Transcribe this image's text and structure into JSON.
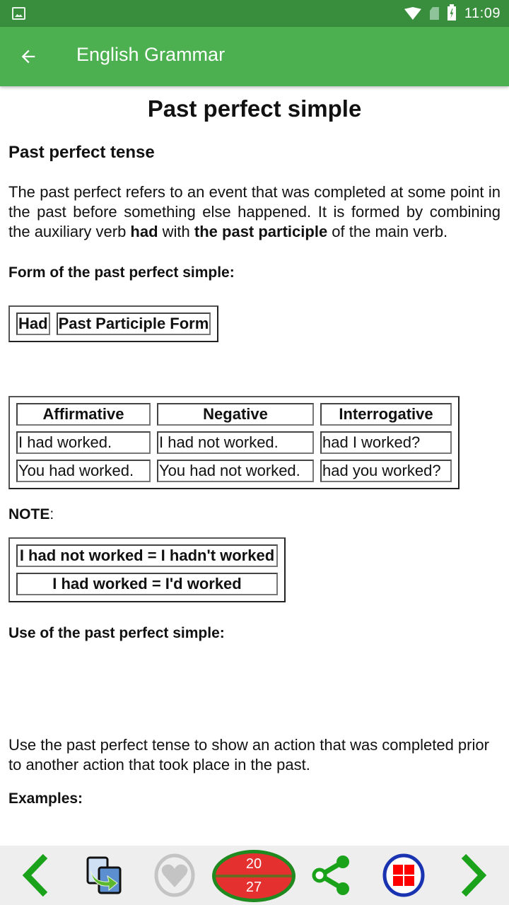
{
  "status_bar": {
    "time": "11:09",
    "icons": [
      "gallery-icon",
      "wifi-icon",
      "no-sim-icon",
      "battery-charging-icon"
    ]
  },
  "app_bar": {
    "title": "English Grammar",
    "back_icon": "arrow-left-icon"
  },
  "page": {
    "title": "Past perfect simple",
    "section_heading": "Past perfect tense",
    "intro": {
      "part1": "The past perfect refers to an event that was completed at some point in the past before something else happened. It is formed by combining the auxiliary verb ",
      "bold1": "had",
      "part2": " with ",
      "bold2": "the past participle",
      "part3": " of the main verb."
    },
    "form_heading": "Form of the past perfect simple:",
    "form_table": [
      "Had",
      "Past Participle Form"
    ],
    "conjugation_table": {
      "headers": [
        "Affirmative",
        "Negative",
        "Interrogative"
      ],
      "rows": [
        [
          "I had worked.",
          "I had not worked.",
          "had I worked?"
        ],
        [
          "You had worked.",
          "You had not worked.",
          "had you worked?"
        ]
      ]
    },
    "note_label": "NOTE",
    "note_suffix": ":",
    "note_table": [
      "I had not worked = I hadn't worked",
      "I had worked = I'd worked"
    ],
    "use_heading": "Use of the past perfect simple:",
    "use_text": "Use the past perfect tense to show an action that was completed prior to another action that took place in the past.",
    "examples_label": "Examples:"
  },
  "bottom_bar": {
    "prev_icon": "chevron-left-icon",
    "switch_icon": "switch-copy-icon",
    "favorite_icon": "heart-icon",
    "counter": {
      "current": "20",
      "total": "27"
    },
    "share_icon": "share-icon",
    "menu_icon": "grid-menu-icon",
    "next_icon": "chevron-right-icon",
    "colors": {
      "green": "#1aa31a",
      "red": "#e53030",
      "blue": "#1a33b0",
      "gray": "#c4c4c4"
    }
  }
}
